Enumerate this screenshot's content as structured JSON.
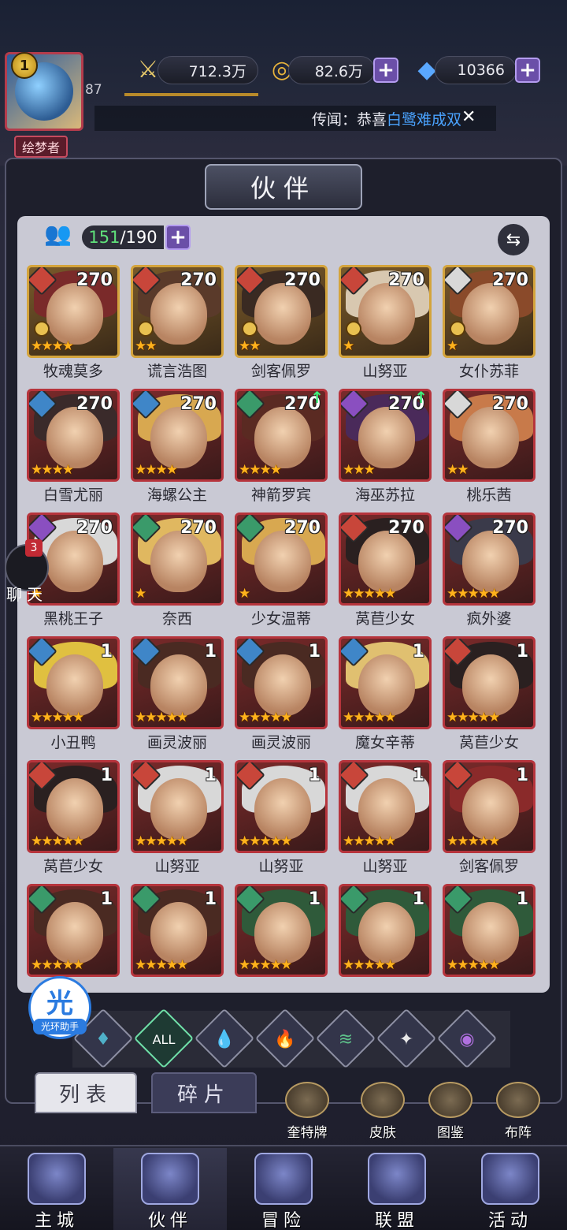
{
  "player": {
    "level": "1",
    "exp_value": "87",
    "title": "绘梦者"
  },
  "resources": {
    "power": "712.3万",
    "gold": "82.6万",
    "diamond": "10366",
    "plus": "+"
  },
  "news": {
    "prefix": "传闻：恭喜",
    "highlight": "白鹭难成双",
    "close": "✕"
  },
  "panel": {
    "title": "伙伴",
    "count_current": "151",
    "count_total": "/190",
    "sort_icon": "⇆"
  },
  "cards": [
    {
      "name": "牧魂莫多",
      "level": "270",
      "stars": 4,
      "frame": "gold",
      "elem": "fire",
      "crown": true
    },
    {
      "name": "谎言浩图",
      "level": "270",
      "stars": 2,
      "frame": "gold",
      "elem": "fire",
      "crown": true
    },
    {
      "name": "剑客佩罗",
      "level": "270",
      "stars": 2,
      "frame": "gold",
      "elem": "fire",
      "crown": true
    },
    {
      "name": "山努亚",
      "level": "270",
      "stars": 1,
      "frame": "gold",
      "elem": "fire",
      "crown": true
    },
    {
      "name": "女仆苏菲",
      "level": "270",
      "stars": 1,
      "frame": "gold",
      "elem": "light",
      "crown": true
    },
    {
      "name": "白雪尤丽",
      "level": "270",
      "stars": 4,
      "frame": "red",
      "elem": "water",
      "crown": false
    },
    {
      "name": "海螺公主",
      "level": "270",
      "stars": 4,
      "frame": "red",
      "elem": "water",
      "crown": false
    },
    {
      "name": "神箭罗宾",
      "level": "270",
      "stars": 4,
      "frame": "red",
      "elem": "wind",
      "up": true
    },
    {
      "name": "海巫苏拉",
      "level": "270",
      "stars": 3,
      "frame": "red",
      "elem": "dark",
      "up": true
    },
    {
      "name": "桃乐茜",
      "level": "270",
      "stars": 2,
      "frame": "red",
      "elem": "light"
    },
    {
      "name": "黑桃王子",
      "level": "270",
      "stars": 1,
      "frame": "red",
      "elem": "dark"
    },
    {
      "name": "奈西",
      "level": "270",
      "stars": 1,
      "frame": "red",
      "elem": "wind"
    },
    {
      "name": "少女温蒂",
      "level": "270",
      "stars": 1,
      "frame": "red",
      "elem": "wind"
    },
    {
      "name": "莴苣少女",
      "level": "270",
      "stars": 5,
      "frame": "red",
      "elem": "fire"
    },
    {
      "name": "疯外婆",
      "level": "270",
      "stars": 5,
      "frame": "red",
      "elem": "dark"
    },
    {
      "name": "小丑鸭",
      "level": "1",
      "stars": 5,
      "frame": "red",
      "elem": "water"
    },
    {
      "name": "画灵波丽",
      "level": "1",
      "stars": 5,
      "frame": "red",
      "elem": "water"
    },
    {
      "name": "画灵波丽",
      "level": "1",
      "stars": 5,
      "frame": "red",
      "elem": "water"
    },
    {
      "name": "魔女辛蒂",
      "level": "1",
      "stars": 5,
      "frame": "red",
      "elem": "water"
    },
    {
      "name": "莴苣少女",
      "level": "1",
      "stars": 5,
      "frame": "red",
      "elem": "fire"
    },
    {
      "name": "莴苣少女",
      "level": "1",
      "stars": 5,
      "frame": "red",
      "elem": "fire"
    },
    {
      "name": "山努亚",
      "level": "1",
      "stars": 5,
      "frame": "red",
      "elem": "fire"
    },
    {
      "name": "山努亚",
      "level": "1",
      "stars": 5,
      "frame": "red",
      "elem": "fire"
    },
    {
      "name": "山努亚",
      "level": "1",
      "stars": 5,
      "frame": "red",
      "elem": "fire"
    },
    {
      "name": "剑客佩罗",
      "level": "1",
      "stars": 5,
      "frame": "red",
      "elem": "fire"
    },
    {
      "name": "",
      "level": "1",
      "stars": 5,
      "frame": "red",
      "elem": "wind"
    },
    {
      "name": "",
      "level": "1",
      "stars": 5,
      "frame": "red",
      "elem": "wind"
    },
    {
      "name": "",
      "level": "1",
      "stars": 5,
      "frame": "red",
      "elem": "wind"
    },
    {
      "name": "",
      "level": "1",
      "stars": 5,
      "frame": "red",
      "elem": "wind"
    },
    {
      "name": "",
      "level": "1",
      "stars": 5,
      "frame": "red",
      "elem": "wind"
    }
  ],
  "filters": [
    {
      "id": "nature",
      "label": "",
      "glyph": "♦",
      "color": "#4fb0c8"
    },
    {
      "id": "all",
      "label": "ALL",
      "glyph": "ALL",
      "color": "#ffffff",
      "selected": true
    },
    {
      "id": "water",
      "label": "",
      "glyph": "💧",
      "color": "#5aa0e8"
    },
    {
      "id": "fire",
      "label": "",
      "glyph": "🔥",
      "color": "#e05040"
    },
    {
      "id": "wind",
      "label": "",
      "glyph": "≋",
      "color": "#5ec08a"
    },
    {
      "id": "light",
      "label": "",
      "glyph": "✦",
      "color": "#e8e8e8"
    },
    {
      "id": "dark",
      "label": "",
      "glyph": "◉",
      "color": "#b070e0"
    }
  ],
  "helper": {
    "glyph": "光",
    "label": "光环助手"
  },
  "chat": {
    "badge": "3",
    "label": "聊天"
  },
  "tabs": {
    "list": "列表",
    "fragments": "碎片"
  },
  "subbuttons": [
    "奎特牌",
    "皮肤",
    "图鉴",
    "布阵"
  ],
  "nav": [
    "主城",
    "伙伴",
    "冒险",
    "联盟",
    "活动"
  ]
}
